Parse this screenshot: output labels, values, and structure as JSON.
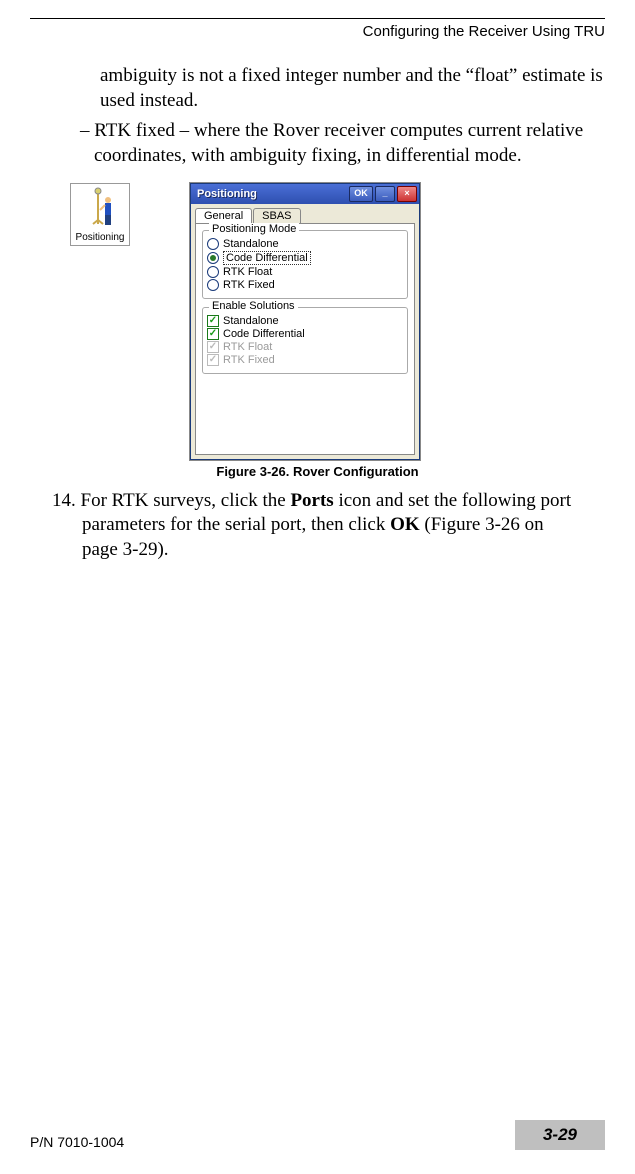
{
  "header": {
    "title": "Configuring the Receiver Using TRU"
  },
  "body": {
    "para_cont": "ambiguity is not a fixed integer number and the “float” estimate is used instead.",
    "sub_rtk_fixed": "– RTK fixed – where the Rover receiver computes current relative coordinates, with ambiguity fixing, in differential mode."
  },
  "positioning_icon": {
    "label": "Positioning"
  },
  "dialog": {
    "title": "Positioning",
    "ok": "OK",
    "min": "_",
    "close": "×",
    "tabs": {
      "general": "General",
      "sbas": "SBAS"
    },
    "group_mode": {
      "title": "Positioning Mode",
      "options": {
        "standalone": "Standalone",
        "code_diff": "Code Differential",
        "rtk_float": "RTK Float",
        "rtk_fixed": "RTK Fixed"
      },
      "selected": "code_diff"
    },
    "group_sol": {
      "title": "Enable Solutions",
      "options": {
        "standalone": "Standalone",
        "code_diff": "Code Differential",
        "rtk_float": "RTK Float",
        "rtk_fixed": "RTK Fixed"
      }
    }
  },
  "figure_caption": "Figure 3-26. Rover Configuration",
  "step14": {
    "num": "14.",
    "pre": " For RTK surveys, click the ",
    "bold1": "Ports",
    "mid": " icon and set the following port parameters for the serial port, then click ",
    "bold2": "OK",
    "post": " (Figure 3-26 on page 3-29)."
  },
  "footer": {
    "pn": "P/N 7010-1004",
    "pagenum": "3-29"
  }
}
